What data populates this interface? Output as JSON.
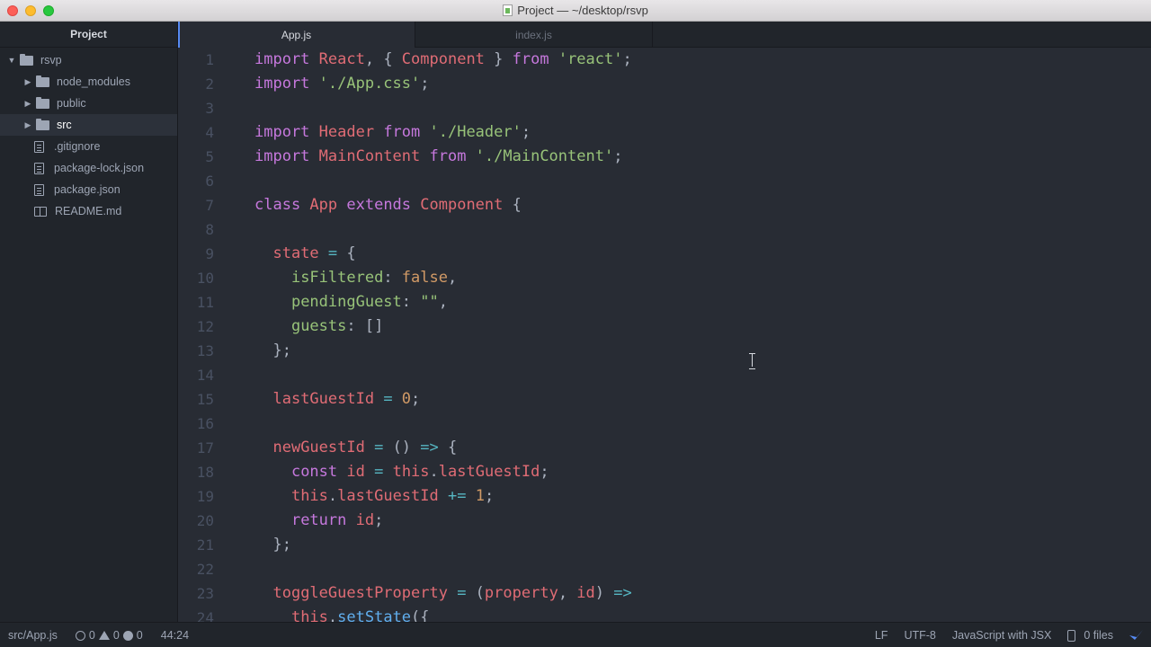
{
  "window": {
    "title": "Project — ~/desktop/rsvp"
  },
  "tree": {
    "header": "Project",
    "items": [
      {
        "label": "rsvp",
        "type": "folder-root",
        "expanded": true
      },
      {
        "label": "node_modules",
        "type": "folder"
      },
      {
        "label": "public",
        "type": "folder"
      },
      {
        "label": "src",
        "type": "folder",
        "selected": true
      },
      {
        "label": ".gitignore",
        "type": "file"
      },
      {
        "label": "package-lock.json",
        "type": "file"
      },
      {
        "label": "package.json",
        "type": "file"
      },
      {
        "label": "README.md",
        "type": "book"
      }
    ]
  },
  "tabs": [
    {
      "label": "App.js",
      "active": true
    },
    {
      "label": "index.js",
      "active": false
    }
  ],
  "editor": {
    "line_numbers": [
      "1",
      "2",
      "3",
      "4",
      "5",
      "6",
      "7",
      "8",
      "9",
      "10",
      "11",
      "12",
      "13",
      "14",
      "15",
      "16",
      "17",
      "18",
      "19",
      "20",
      "21",
      "22",
      "23",
      "24"
    ],
    "lines": [
      [
        [
          "kw",
          "import "
        ],
        [
          "ty",
          "React"
        ],
        [
          "plain",
          ", { "
        ],
        [
          "ty",
          "Component"
        ],
        [
          "plain",
          " } "
        ],
        [
          "kw",
          "from "
        ],
        [
          "str",
          "'react'"
        ],
        [
          "plain",
          ";"
        ]
      ],
      [
        [
          "kw",
          "import "
        ],
        [
          "str",
          "'./App.css'"
        ],
        [
          "plain",
          ";"
        ]
      ],
      [],
      [
        [
          "kw",
          "import "
        ],
        [
          "ty",
          "Header "
        ],
        [
          "kw",
          "from "
        ],
        [
          "str",
          "'./Header'"
        ],
        [
          "plain",
          ";"
        ]
      ],
      [
        [
          "kw",
          "import "
        ],
        [
          "ty",
          "MainContent "
        ],
        [
          "kw",
          "from "
        ],
        [
          "str",
          "'./MainContent'"
        ],
        [
          "plain",
          ";"
        ]
      ],
      [],
      [
        [
          "kw",
          "class "
        ],
        [
          "ty",
          "App "
        ],
        [
          "kw",
          "extends "
        ],
        [
          "ty",
          "Component"
        ],
        [
          "plain",
          " {"
        ]
      ],
      [],
      [
        [
          "plain",
          "  "
        ],
        [
          "pm",
          "state"
        ],
        [
          "op",
          " = "
        ],
        [
          "plain",
          "{"
        ]
      ],
      [
        [
          "plain",
          "    "
        ],
        [
          "key",
          "isFiltered"
        ],
        [
          "plain",
          ": "
        ],
        [
          "num",
          "false"
        ],
        [
          "plain",
          ","
        ]
      ],
      [
        [
          "plain",
          "    "
        ],
        [
          "key",
          "pendingGuest"
        ],
        [
          "plain",
          ": "
        ],
        [
          "str",
          "\"\""
        ],
        [
          "plain",
          ","
        ]
      ],
      [
        [
          "plain",
          "    "
        ],
        [
          "key",
          "guests"
        ],
        [
          "plain",
          ": []"
        ]
      ],
      [
        [
          "plain",
          "  };"
        ]
      ],
      [],
      [
        [
          "plain",
          "  "
        ],
        [
          "pm",
          "lastGuestId"
        ],
        [
          "op",
          " = "
        ],
        [
          "num",
          "0"
        ],
        [
          "plain",
          ";"
        ]
      ],
      [],
      [
        [
          "plain",
          "  "
        ],
        [
          "pm",
          "newGuestId"
        ],
        [
          "op",
          " = "
        ],
        [
          "plain",
          "() "
        ],
        [
          "op",
          "=>"
        ],
        [
          "plain",
          " {"
        ]
      ],
      [
        [
          "plain",
          "    "
        ],
        [
          "kw",
          "const "
        ],
        [
          "pm",
          "id"
        ],
        [
          "op",
          " = "
        ],
        [
          "ty",
          "this"
        ],
        [
          "plain",
          "."
        ],
        [
          "pm",
          "lastGuestId"
        ],
        [
          "plain",
          ";"
        ]
      ],
      [
        [
          "plain",
          "    "
        ],
        [
          "ty",
          "this"
        ],
        [
          "plain",
          "."
        ],
        [
          "pm",
          "lastGuestId"
        ],
        [
          "op",
          " += "
        ],
        [
          "num",
          "1"
        ],
        [
          "plain",
          ";"
        ]
      ],
      [
        [
          "plain",
          "    "
        ],
        [
          "kw",
          "return "
        ],
        [
          "pm",
          "id"
        ],
        [
          "plain",
          ";"
        ]
      ],
      [
        [
          "plain",
          "  };"
        ]
      ],
      [],
      [
        [
          "plain",
          "  "
        ],
        [
          "pm",
          "toggleGuestProperty"
        ],
        [
          "op",
          " = "
        ],
        [
          "plain",
          "("
        ],
        [
          "pm",
          "property"
        ],
        [
          "plain",
          ", "
        ],
        [
          "pm",
          "id"
        ],
        [
          "plain",
          ") "
        ],
        [
          "op",
          "=>"
        ]
      ],
      [
        [
          "plain",
          "    "
        ],
        [
          "ty",
          "this"
        ],
        [
          "plain",
          "."
        ],
        [
          "fn",
          "setState"
        ],
        [
          "plain",
          "({"
        ]
      ]
    ]
  },
  "status": {
    "file_path": "src/App.js",
    "errors": "0",
    "warnings": "0",
    "infos": "0",
    "cursor_position": "44:24",
    "line_ending": "LF",
    "encoding": "UTF-8",
    "grammar": "JavaScript with JSX",
    "files_count": "0 files"
  }
}
